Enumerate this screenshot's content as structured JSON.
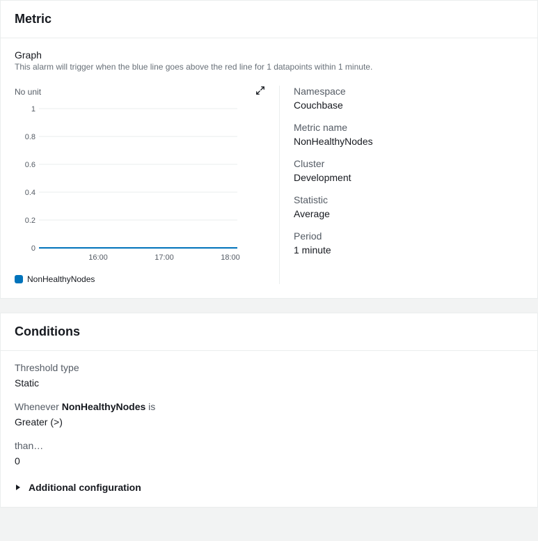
{
  "metric_panel": {
    "title": "Metric",
    "graph_heading": "Graph",
    "graph_desc": "This alarm will trigger when the blue line goes above the red line for 1 datapoints within 1 minute.",
    "chart_unit": "No unit",
    "legend_label": "NonHealthyNodes",
    "meta": {
      "namespace_label": "Namespace",
      "namespace_value": "Couchbase",
      "metric_name_label": "Metric name",
      "metric_name_value": "NonHealthyNodes",
      "cluster_label": "Cluster",
      "cluster_value": "Development",
      "statistic_label": "Statistic",
      "statistic_value": "Average",
      "period_label": "Period",
      "period_value": "1 minute"
    }
  },
  "conditions_panel": {
    "title": "Conditions",
    "threshold_type_label": "Threshold type",
    "threshold_type_value": "Static",
    "whenever_prefix": "Whenever ",
    "whenever_metric": "NonHealthyNodes",
    "whenever_suffix": " is",
    "comparison_value": "Greater (>)",
    "than_label": "than…",
    "than_value": "0",
    "additional_config": "Additional configuration"
  },
  "chart_data": {
    "type": "line",
    "title": "",
    "xlabel": "",
    "ylabel": "No unit",
    "x_ticks": [
      "16:00",
      "17:00",
      "18:00"
    ],
    "y_ticks": [
      0,
      0.2,
      0.4,
      0.6,
      0.8,
      1
    ],
    "ylim": [
      0,
      1
    ],
    "threshold": 0,
    "series": [
      {
        "name": "NonHealthyNodes",
        "color": "#0073bb",
        "values": [
          0,
          0,
          0,
          0,
          0,
          0,
          0,
          0,
          0,
          0,
          0
        ]
      }
    ]
  }
}
